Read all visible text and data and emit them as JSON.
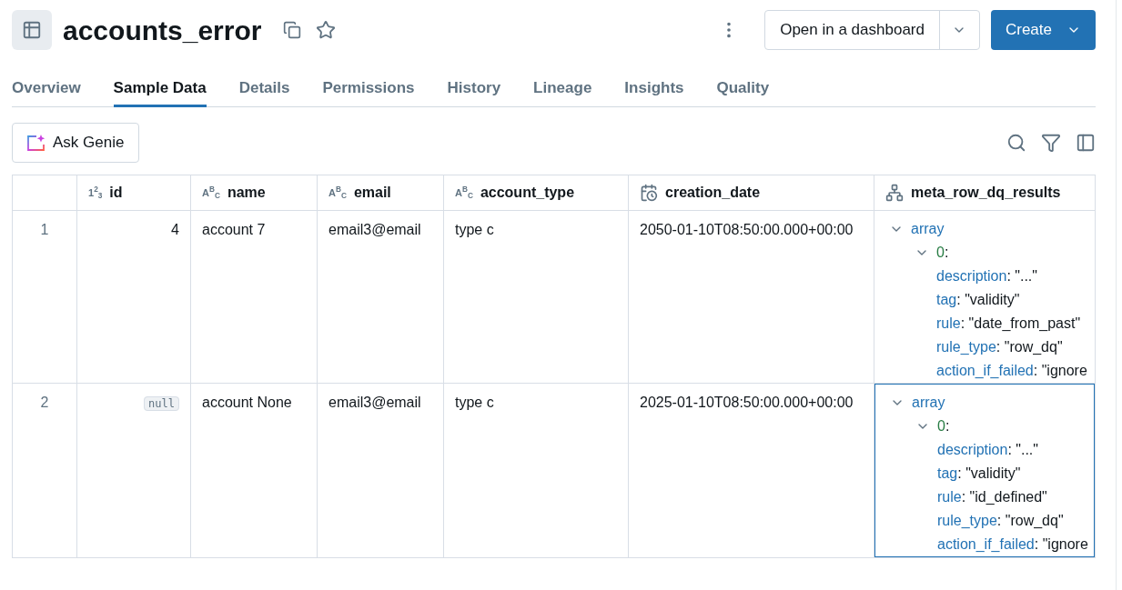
{
  "header": {
    "title": "accounts_error",
    "open_button": "Open in a dashboard",
    "create_button": "Create"
  },
  "tabs": [
    {
      "label": "Overview",
      "selected": false
    },
    {
      "label": "Sample Data",
      "selected": true
    },
    {
      "label": "Details",
      "selected": false
    },
    {
      "label": "Permissions",
      "selected": false
    },
    {
      "label": "History",
      "selected": false
    },
    {
      "label": "Lineage",
      "selected": false
    },
    {
      "label": "Insights",
      "selected": false
    },
    {
      "label": "Quality",
      "selected": false
    }
  ],
  "toolbar": {
    "ask_button": "Ask Genie"
  },
  "table": {
    "columns": [
      {
        "label": "id",
        "kind": "number",
        "type_glyph": "1$^{2}$$_{3}$"
      },
      {
        "label": "name",
        "kind": "string",
        "type_glyph": "A$^{B}$$_{C}$"
      },
      {
        "label": "email",
        "kind": "string",
        "type_glyph": "A$^{B}$$_{C}$"
      },
      {
        "label": "account_type",
        "kind": "string",
        "type_glyph": "A$^{B}$$_{C}$"
      },
      {
        "label": "creation_date",
        "kind": "date"
      },
      {
        "label": "meta_row_dq_results",
        "kind": "struct"
      }
    ],
    "rows": [
      {
        "number": "1",
        "cells": [
          {
            "kind": "number",
            "value": "4"
          },
          {
            "kind": "text",
            "value": "account 7"
          },
          {
            "kind": "text",
            "value": "email3@email"
          },
          {
            "kind": "text",
            "value": "type c"
          },
          {
            "kind": "text",
            "value": "2050-01-10T08:50:00.000+00:00"
          },
          {
            "kind": "tree",
            "selected": false,
            "label": "array",
            "expanded": true,
            "children": [
              {
                "label": "0",
                "suffix": ":",
                "expanded": true,
                "fields": [
                  {
                    "key": "description",
                    "value": ": \"...\""
                  },
                  {
                    "key": "tag",
                    "value": ": \"validity\""
                  },
                  {
                    "key": "rule",
                    "value": ": \"date_from_past\""
                  },
                  {
                    "key": "rule_type",
                    "value": ": \"row_dq\""
                  },
                  {
                    "key": "action_if_failed",
                    "value": ": \"ignore"
                  }
                ]
              }
            ]
          }
        ]
      },
      {
        "number": "2",
        "cells": [
          {
            "kind": "null",
            "value": "null"
          },
          {
            "kind": "text",
            "value": "account None"
          },
          {
            "kind": "text",
            "value": "email3@email"
          },
          {
            "kind": "text",
            "value": "type c"
          },
          {
            "kind": "text",
            "value": "2025-01-10T08:50:00.000+00:00"
          },
          {
            "kind": "tree",
            "selected": true,
            "label": "array",
            "expanded": true,
            "children": [
              {
                "label": "0",
                "suffix": ":",
                "expanded": true,
                "fields": [
                  {
                    "key": "description",
                    "value": ": \"...\""
                  },
                  {
                    "key": "tag",
                    "value": ": \"validity\""
                  },
                  {
                    "key": "rule",
                    "value": ": \"id_defined\""
                  },
                  {
                    "key": "rule_type",
                    "value": ": \"row_dq\""
                  },
                  {
                    "key": "action_if_failed",
                    "value": ": \"ignore"
                  }
                ]
              }
            ]
          }
        ]
      }
    ]
  }
}
